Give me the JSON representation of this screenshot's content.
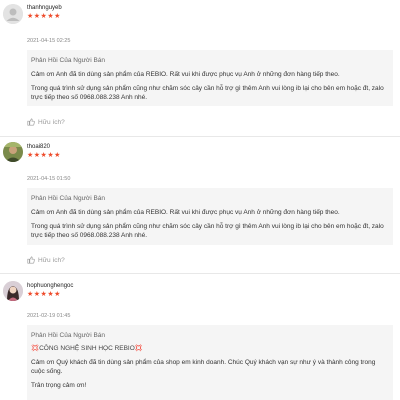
{
  "colors": {
    "star": "#ee4d2d",
    "reply_bg": "#f5f5f5",
    "muted": "#999999"
  },
  "reviews": [
    {
      "username": "thanhnguyeb",
      "stars": "★★★★★",
      "time": "2021-04-15 02:25",
      "reply_title": "Phản Hồi Của Người Bán",
      "reply_p1": "Cảm ơn Anh đã tin dùng sản phẩm của REBIO. Rất vui khi được phục vụ Anh ở những đơn hàng tiếp theo.",
      "reply_p2": "Trong quá trình sử dụng sản phẩm cũng như chăm sóc cây cần hỗ trợ gì thêm Anh vui lòng ib lại cho bên em hoặc đt, zalo trực tiếp theo số 0968.088.238 Anh nhé.",
      "like_label": "Hữu ích?",
      "avatar_icon": "default-avatar-icon"
    },
    {
      "username": "thoai820",
      "stars": "★★★★★",
      "time": "2021-04-15 01:50",
      "reply_title": "Phản Hồi Của Người Bán",
      "reply_p1": "Cảm ơn Anh đã tin dùng sản phẩm của REBIO. Rất vui khi được phục vụ Anh ở những đơn hàng tiếp theo.",
      "reply_p2": "Trong quá trình sử dụng sản phẩm cũng như chăm sóc cây cần hỗ trợ gì thêm Anh vui lòng ib lại cho bên em hoặc đt, zalo trực tiếp theo số 0968.088.238 Anh nhé.",
      "like_label": "Hữu ích?",
      "avatar_icon": "photo-avatar-icon"
    },
    {
      "username": "hophuonghengoc",
      "stars": "★★★★★",
      "time": "2021-02-19 01:45",
      "reply_title": "Phản Hồi Của Người Bán",
      "reply_p1": "💢CÔNG NGHỆ SINH HỌC REBIO💢",
      "reply_p2": "Cảm ơn Quý khách đã tin dùng sản phẩm của shop em kinh doanh. Chúc Quý khách vạn sự như ý và thành công trong cuộc sống.",
      "reply_p3": "Trân trọng cảm ơn!",
      "avatar_icon": "photo-avatar-icon"
    }
  ]
}
